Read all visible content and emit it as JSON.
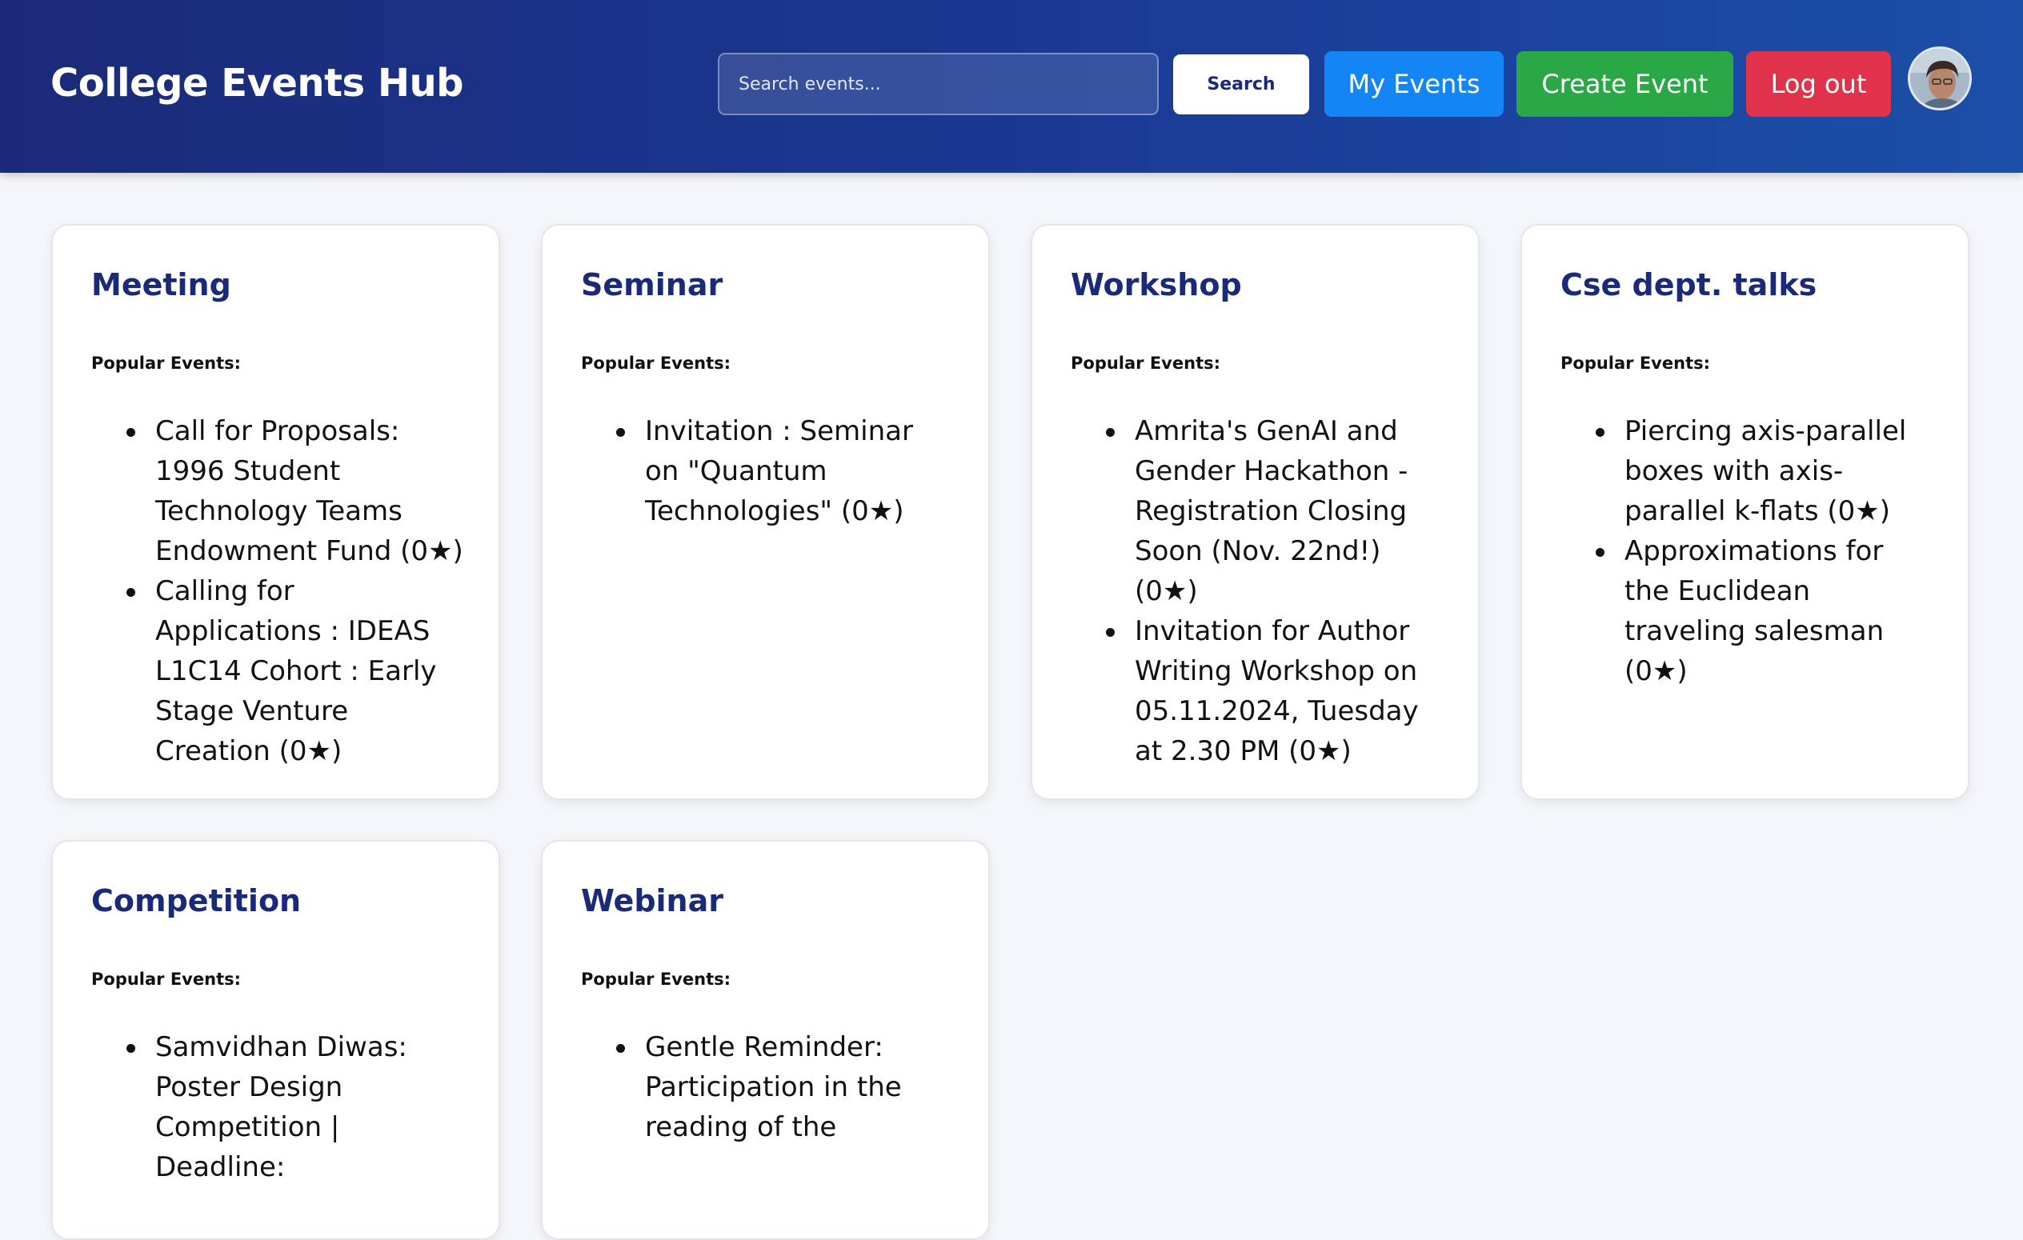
{
  "header": {
    "brand": "College Events Hub",
    "search_placeholder": "Search events...",
    "search_button": "Search",
    "my_events_button": "My Events",
    "create_event_button": "Create Event",
    "logout_button": "Log out"
  },
  "popular_label": "Popular Events:",
  "categories": [
    {
      "title": "Meeting",
      "events": [
        "Call for Proposals: 1996 Student Technology Teams Endowment Fund (0★)",
        "Calling for Applications : IDEAS L1C14 Cohort : Early Stage Venture Creation (0★)"
      ]
    },
    {
      "title": "Seminar",
      "events": [
        "Invitation : Seminar on \"Quantum Technologies\" (0★)"
      ]
    },
    {
      "title": "Workshop",
      "events": [
        "Amrita's GenAI and Gender Hackathon - Registration Closing Soon (Nov. 22nd!) (0★)",
        "Invitation for Author Writing Workshop on 05.11.2024, Tuesday at 2.30 PM (0★)"
      ]
    },
    {
      "title": "Cse dept. talks",
      "events": [
        "Piercing axis-parallel boxes with axis-parallel k-flats (0★)",
        "Approximations for the Euclidean traveling salesman (0★)"
      ]
    },
    {
      "title": "Competition",
      "events": [
        "Samvidhan Diwas: Poster Design Competition | Deadline:"
      ]
    },
    {
      "title": "Webinar",
      "events": [
        "Gentle Reminder: Participation in the reading of the"
      ]
    }
  ]
}
